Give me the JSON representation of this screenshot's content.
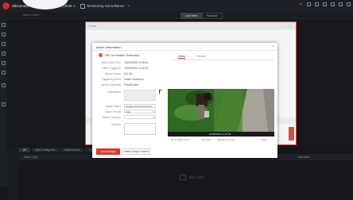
{
  "app": {
    "title": "HikCentral Professional Control Client"
  },
  "module_tab": {
    "label": "Monitoring Surveillance"
  },
  "subbar": {
    "label": "Alarm Center",
    "view_live": "Live View",
    "view_playback": "Playback"
  },
  "outer_window": {
    "title": "Event",
    "controls": "— □ ×"
  },
  "dialog": {
    "title": "Alarm Information",
    "event_name": "SN: 1b Motion Detection",
    "info_labels": [
      "Alarm Start Time",
      "Alarm Triggered",
      "Alarm Source",
      "Triggering Event",
      "Device (Camera)",
      "Description"
    ],
    "info_values": [
      "2020/08/06 11:18:48",
      "2020/08/06 11:18:48",
      "SN: 1b",
      "Motion Detection",
      "Parade Alert",
      "",
      ""
    ],
    "form_labels": [
      "Alarm Status",
      "Alarm Priority",
      "Alarm Category",
      "Remark"
    ],
    "form_values": [
      "Handle Unacknowledged",
      "High",
      "",
      ""
    ],
    "primary_button": "Acknowledge",
    "secondary_button": "Switch Output Control"
  },
  "media": {
    "tabs": [
      "Video",
      "Picture"
    ],
    "time": "2020/08/06 11:18:48",
    "actions": [
      "Go to Alarm Time",
      "Live View",
      "Display as Group",
      "Save"
    ]
  },
  "bottom": {
    "tabs": [
      "All",
      "Alarm Categories",
      "Alarm Source",
      "Event Level"
    ],
    "col_left": "Alarm Type",
    "col_right": "Operation",
    "empty": "No Data"
  }
}
